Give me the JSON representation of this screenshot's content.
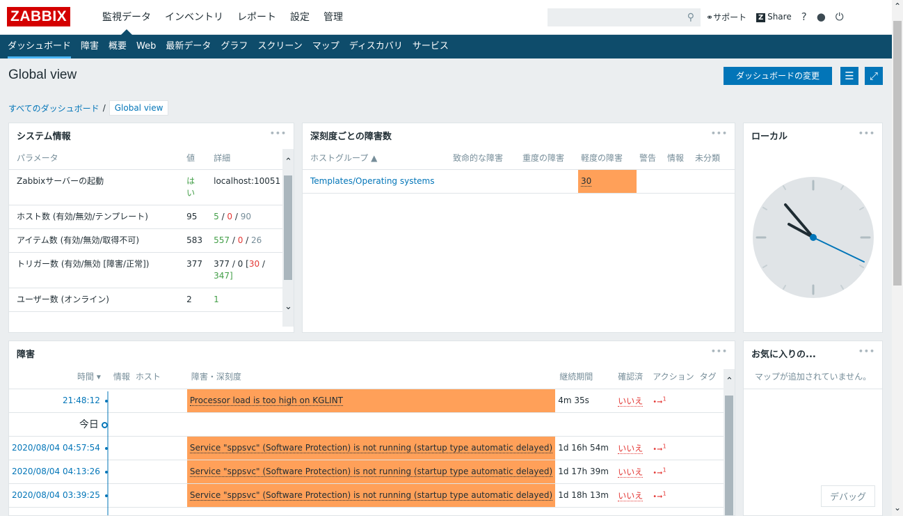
{
  "app": {
    "logo": "ZABBIX"
  },
  "topmenu": [
    "監視データ",
    "インベントリ",
    "レポート",
    "設定",
    "管理"
  ],
  "search": {
    "value": ""
  },
  "topright": {
    "support": "サポート",
    "share": "Share",
    "help": "?"
  },
  "submenu": [
    "ダッシュボード",
    "障害",
    "概要",
    "Web",
    "最新データ",
    "グラフ",
    "スクリーン",
    "マップ",
    "ディスカバリ",
    "サービス"
  ],
  "page": {
    "title": "Global view",
    "edit_button": "ダッシュボードの変更"
  },
  "breadcrumb": {
    "root": "すべてのダッシュボード",
    "sep": "/",
    "current": "Global view"
  },
  "sysinfo": {
    "title": "システム情報",
    "headers": [
      "パラメータ",
      "値",
      "詳細"
    ],
    "rows": [
      {
        "param": "Zabbixサーバーの起動",
        "value": "はい",
        "d1": "localhost:10051",
        "d2": "",
        "d3": "",
        "d4": "",
        "d5": ""
      },
      {
        "param": "ホスト数 (有効/無効/テンプレート)",
        "value": "95",
        "d1": "5",
        "d2": "0",
        "d3": "90"
      },
      {
        "param": "アイテム数 (有効/無効/取得不可)",
        "value": "583",
        "d1": "557",
        "d2": "0",
        "d3": "26"
      },
      {
        "param": "トリガー数 (有効/無効 [障害/正常])",
        "value": "377",
        "d1": "377 / 0 [",
        "d2": "30",
        "d3": "347]"
      },
      {
        "param": "ユーザー数 (オンライン)",
        "value": "2",
        "d1": "1"
      }
    ]
  },
  "severity": {
    "title": "深刻度ごとの障害数",
    "headers": [
      "ホストグループ ▲",
      "致命的な障害",
      "重度の障害",
      "軽度の障害",
      "警告",
      "情報",
      "未分類"
    ],
    "rows": [
      {
        "group": "Templates/Operating systems",
        "disaster": "",
        "high": "",
        "average": "30",
        "warning": "",
        "info": "",
        "nc": ""
      }
    ]
  },
  "clock": {
    "title": "ローカル"
  },
  "problems": {
    "title": "障害",
    "headers": [
      "時間 ▾",
      "情報",
      "ホスト",
      "障害・深刻度",
      "継続期間",
      "確認済",
      "アクション",
      "タグ"
    ],
    "today_label": "今日",
    "rows": [
      {
        "time": "21:48:12",
        "problem": "Processor load is too high on KGLINT",
        "duration": "4m 35s",
        "ack": "いいえ",
        "actions": "1"
      },
      {
        "time": "2020/08/04 04:57:54",
        "problem": "Service \"sppsvc\" (Software Protection) is not running (startup type automatic delayed)",
        "duration": "1d 16h 54m",
        "ack": "いいえ",
        "actions": "1"
      },
      {
        "time": "2020/08/04 04:13:26",
        "problem": "Service \"sppsvc\" (Software Protection) is not running (startup type automatic delayed)",
        "duration": "1d 17h 39m",
        "ack": "いいえ",
        "actions": "1"
      },
      {
        "time": "2020/08/04 03:39:25",
        "problem": "Service \"sppsvc\" (Software Protection) is not running (startup type automatic delayed)",
        "duration": "1d 18h 13m",
        "ack": "いいえ",
        "actions": "1"
      }
    ]
  },
  "favorites": {
    "title": "お気に入りの...",
    "empty": "マップが追加されていません。",
    "debug": "デバッグ"
  },
  "colors": {
    "brand": "#d40000",
    "nav": "#0e4c6b",
    "accent": "#0275b8",
    "average": "#ffa059"
  }
}
